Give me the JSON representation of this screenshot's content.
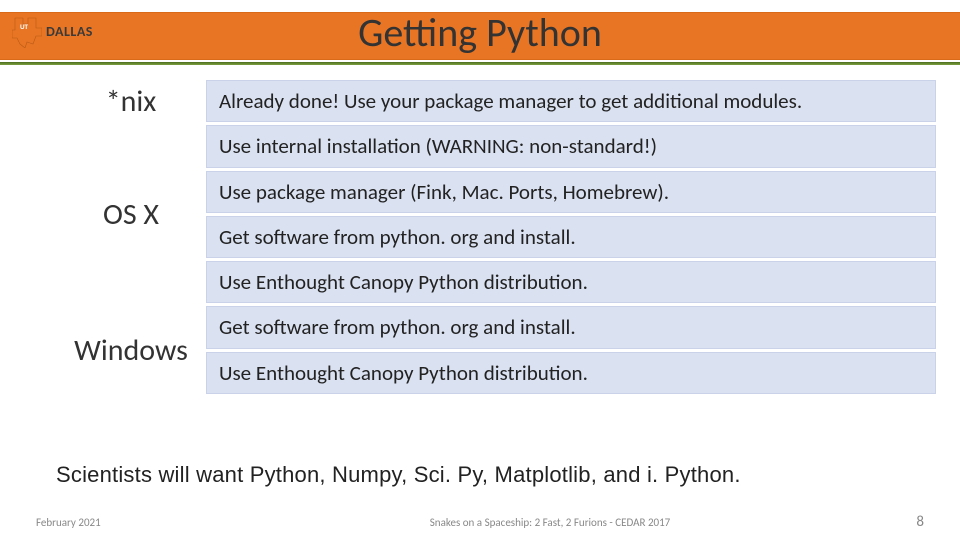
{
  "header": {
    "logo_text": "DALLAS",
    "title": "Getting Python"
  },
  "rows": [
    {
      "os": "*nix",
      "items": [
        "Already done!  Use your package manager to get additional modules."
      ]
    },
    {
      "os": "OS X",
      "items": [
        "Use internal installation (WARNING: non-standard!)",
        "Use package manager (Fink, Mac. Ports, Homebrew).",
        "Get software from python. org and install.",
        "Use Enthought Canopy Python distribution."
      ]
    },
    {
      "os": "Windows",
      "items": [
        "Get software from python. org and install.",
        "Use Enthought Canopy Python distribution."
      ]
    }
  ],
  "note": "Scientists will want Python, Numpy, Sci. Py, Matplotlib, and i. Python.",
  "footer": {
    "date": "February 2021",
    "center": "Snakes on a Spaceship: 2 Fast, 2 Furions - CEDAR 2017",
    "page": "8"
  },
  "colors": {
    "accent": "#e87524",
    "cell_bg": "#dae1f1"
  }
}
